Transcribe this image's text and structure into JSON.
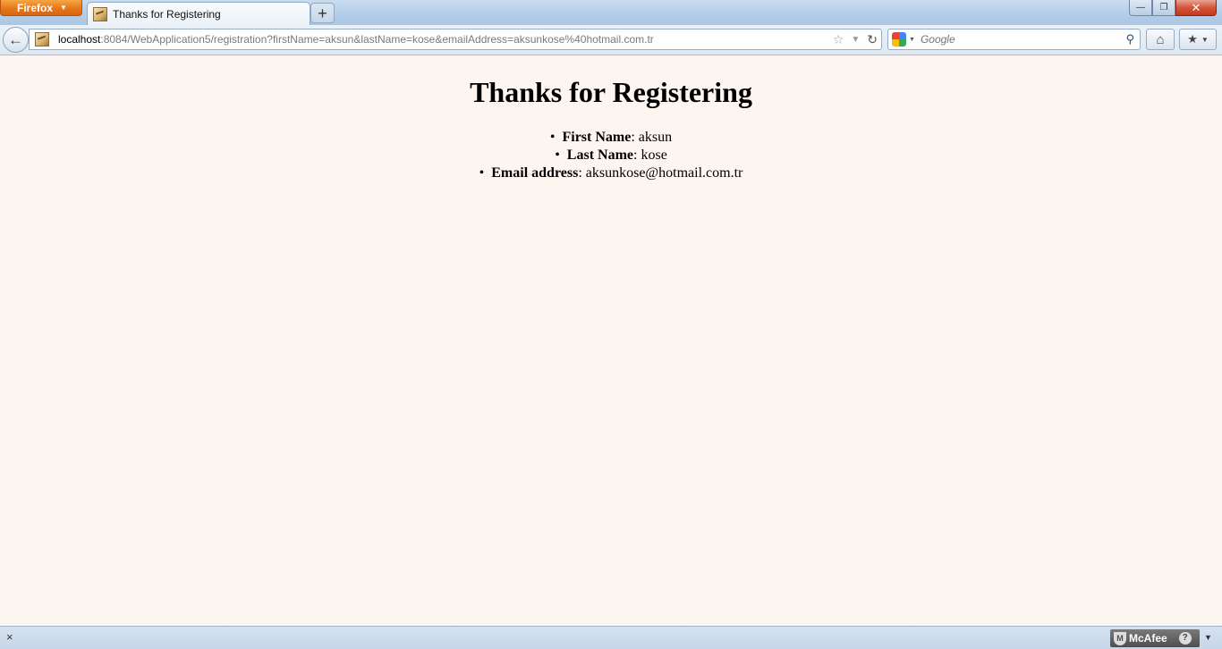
{
  "browser": {
    "menu_button_label": "Firefox",
    "tab_title": "Thanks for Registering",
    "new_tab_label": "+",
    "window_controls": {
      "minimize": "—",
      "restore": "❐",
      "close": "✕"
    },
    "url_host": "localhost",
    "url_rest": ":8084/WebApplication5/registration?firstName=aksun&lastName=kose&emailAddress=aksunkose%40hotmail.com.tr",
    "search_placeholder": "Google",
    "icons": {
      "back": "back-arrow-icon",
      "star": "bookmark-star-icon",
      "history_dropdown": "history-dropdown-icon",
      "reload": "reload-icon",
      "search_engine": "google-logo-icon",
      "search_go": "magnifier-icon",
      "home": "home-icon",
      "bookmarks": "bookmarks-icon"
    },
    "status_close_label": "×",
    "addon": {
      "label": "McAfee",
      "help": "?"
    }
  },
  "page": {
    "heading": "Thanks for Registering",
    "fields": [
      {
        "label": "First Name",
        "value": ": aksun"
      },
      {
        "label": "Last Name",
        "value": ": kose"
      },
      {
        "label": "Email address",
        "value": ": aksunkose@hotmail.com.tr"
      }
    ]
  }
}
